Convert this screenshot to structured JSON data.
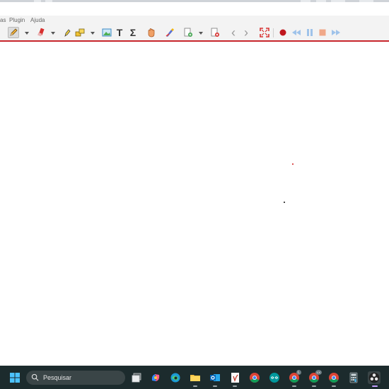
{
  "menu": {
    "items": [
      "as",
      "Plugin",
      "Ajuda"
    ]
  },
  "toolbar": {
    "buttons": [
      {
        "name": "pencil-icon"
      },
      {
        "name": "eraser-icon"
      },
      {
        "name": "highlighter-icon"
      },
      {
        "name": "shapes-icon"
      },
      {
        "name": "image-icon"
      },
      {
        "name": "text-icon",
        "glyph": "T"
      },
      {
        "name": "sigma-icon",
        "glyph": "Σ"
      },
      {
        "name": "hand-icon"
      },
      {
        "name": "magic-pen-icon"
      },
      {
        "name": "new-page-icon"
      },
      {
        "name": "delete-page-icon"
      },
      {
        "name": "prev-page-icon",
        "glyph": "‹"
      },
      {
        "name": "next-page-icon",
        "glyph": "›"
      },
      {
        "name": "fullscreen-icon"
      },
      {
        "name": "record-icon"
      },
      {
        "name": "rewind-icon"
      },
      {
        "name": "pause-icon"
      },
      {
        "name": "stop-icon"
      },
      {
        "name": "fast-forward-icon"
      }
    ]
  },
  "canvas": {
    "dots": [
      {
        "color": "#d11b1b"
      },
      {
        "color": "#111111"
      }
    ]
  },
  "taskbar": {
    "search_placeholder": "Pesquisar",
    "apps": [
      "windows-start-icon",
      "search-icon",
      "task-view-icon",
      "copilot-icon",
      "edge-icon",
      "file-explorer-icon",
      "outlook-icon",
      "word-icon",
      "chrome-icon",
      "arduino-icon",
      "chrome-profile-1-icon",
      "chrome-profile-2-icon",
      "chrome-profile-3-icon",
      "calculator-icon",
      "obs-icon"
    ],
    "badges": [
      "L",
      "LX"
    ]
  },
  "colors": {
    "accent_red": "#c8262c",
    "taskbar_bg": "#1c2b2d"
  }
}
